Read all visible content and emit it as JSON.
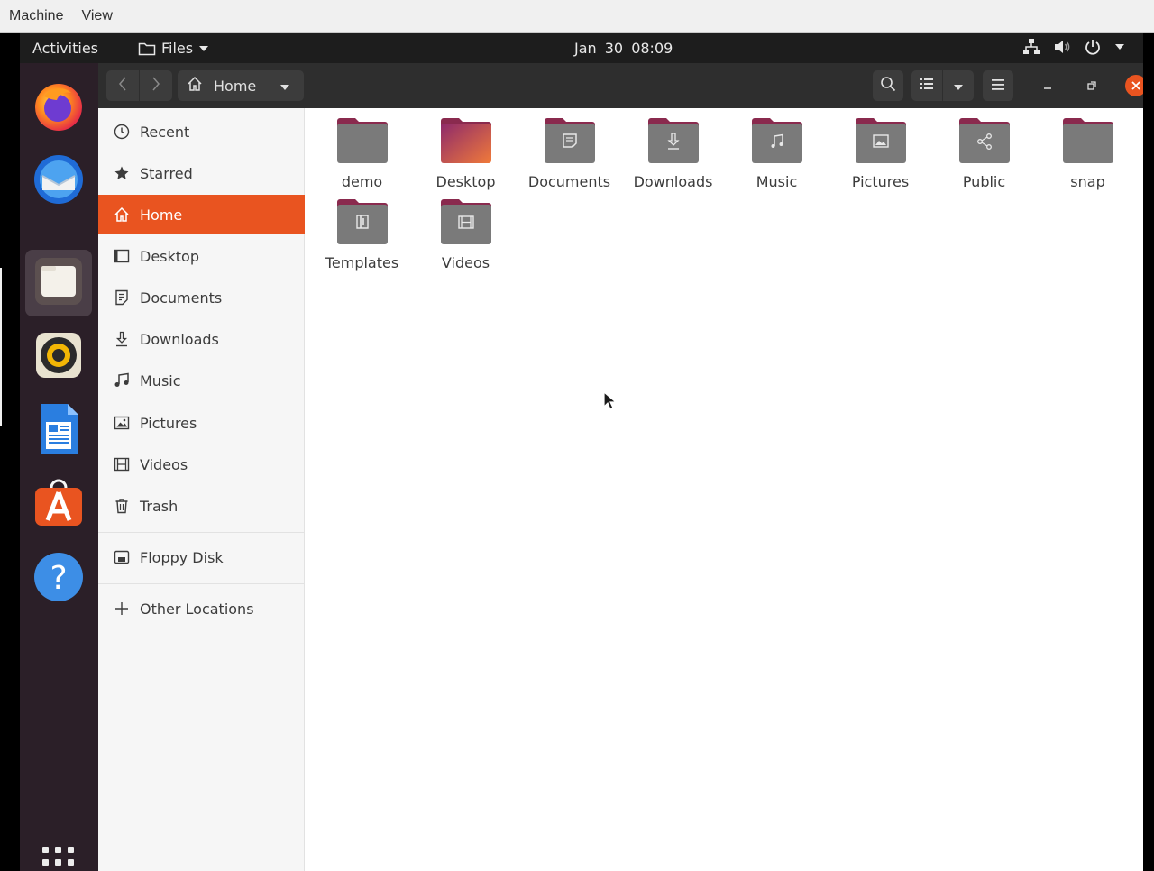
{
  "vm_menu": {
    "items": [
      {
        "label": "Machine"
      },
      {
        "label": "View"
      }
    ]
  },
  "topbar": {
    "activities": "Activities",
    "app_menu": "Files",
    "clock": "Jan 30  08:09",
    "tray_icons": [
      "network-icon",
      "volume-icon",
      "power-icon",
      "chevron-down-icon"
    ]
  },
  "dock": {
    "apps": [
      {
        "name": "Firefox",
        "icon": "firefox-icon"
      },
      {
        "name": "Thunderbird",
        "icon": "thunderbird-icon"
      },
      {
        "name": "Files",
        "icon": "files-icon",
        "active": true
      },
      {
        "name": "Rhythmbox",
        "icon": "rhythmbox-icon"
      },
      {
        "name": "LibreOffice Writer",
        "icon": "writer-icon"
      },
      {
        "name": "Ubuntu Software",
        "icon": "software-icon"
      },
      {
        "name": "Help",
        "icon": "help-icon"
      }
    ],
    "show_apps_icon": "app-grid-icon"
  },
  "headerbar": {
    "path_label": "Home",
    "icons": [
      "back-icon",
      "forward-icon",
      "home-icon",
      "search-icon",
      "list-view-icon",
      "chevron-down-icon",
      "menu-icon",
      "minimize-icon",
      "maximize-icon",
      "close-icon"
    ]
  },
  "sidebar": {
    "items": [
      {
        "label": "Recent",
        "icon": "clock-icon"
      },
      {
        "label": "Starred",
        "icon": "star-icon"
      },
      {
        "label": "Home",
        "icon": "home-icon",
        "selected": true
      },
      {
        "label": "Desktop",
        "icon": "desktop-icon"
      },
      {
        "label": "Documents",
        "icon": "document-icon"
      },
      {
        "label": "Downloads",
        "icon": "download-icon"
      },
      {
        "label": "Music",
        "icon": "music-icon"
      },
      {
        "label": "Pictures",
        "icon": "picture-icon"
      },
      {
        "label": "Videos",
        "icon": "video-icon"
      },
      {
        "label": "Trash",
        "icon": "trash-icon"
      }
    ],
    "devices": [
      {
        "label": "Floppy Disk",
        "icon": "floppy-icon"
      }
    ],
    "other": [
      {
        "label": "Other Locations",
        "icon": "plus-icon"
      }
    ]
  },
  "files": [
    {
      "label": "demo",
      "emblem": "none"
    },
    {
      "label": "Desktop",
      "emblem": "desktop"
    },
    {
      "label": "Documents",
      "emblem": "document"
    },
    {
      "label": "Downloads",
      "emblem": "download"
    },
    {
      "label": "Music",
      "emblem": "music"
    },
    {
      "label": "Pictures",
      "emblem": "picture"
    },
    {
      "label": "Public",
      "emblem": "share"
    },
    {
      "label": "snap",
      "emblem": "none"
    },
    {
      "label": "Templates",
      "emblem": "template"
    },
    {
      "label": "Videos",
      "emblem": "video"
    }
  ],
  "colors": {
    "accent": "#e95420",
    "folder": "#7a7a7a",
    "folder_tab": "#8a2a4e",
    "dock_bg": "#2b1f28"
  }
}
